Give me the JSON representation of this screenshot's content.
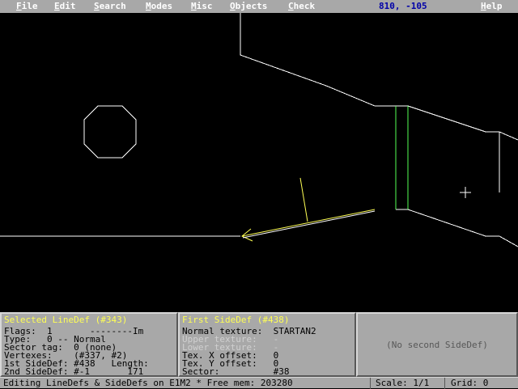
{
  "menu": {
    "items": [
      {
        "key": "F",
        "rest": "ile"
      },
      {
        "key": "E",
        "rest": "dit"
      },
      {
        "key": "S",
        "rest": "earch"
      },
      {
        "key": "M",
        "rest": "odes"
      },
      {
        "key": "M",
        "rest": "isc"
      },
      {
        "key": "O",
        "rest": "bjects"
      },
      {
        "key": "C",
        "rest": "heck"
      },
      {
        "key": "H",
        "rest": "elp"
      }
    ],
    "coords": "810, -105"
  },
  "colors": {
    "menubar": "#a8a8a8",
    "panel_title": "#ffff54",
    "coords": "#0000a8",
    "map_lines": "#ffffff",
    "selected_line": "#ffff54",
    "two_sided_line": "#54ff54"
  },
  "linedef_panel": {
    "title": "Selected LineDef (#343)",
    "rows": [
      "Flags:  1       --------Im",
      "Type:   0 -- Normal",
      "Sector tag:  0 (none)",
      "Vertexes:    (#337, #2)",
      "1st SideDef: #438   Length:",
      "2nd SideDef: #-1       171"
    ]
  },
  "sidedef1_panel": {
    "title": "First SideDef (#438)",
    "rows": [
      {
        "text": "Normal texture:  STARTAN2",
        "dim": false
      },
      {
        "text": "Upper texture:   -",
        "dim": true
      },
      {
        "text": "Lower texture:   -",
        "dim": true
      },
      {
        "text": "Tex. X offset:   0",
        "dim": false
      },
      {
        "text": "Tex. Y offset:   0",
        "dim": false
      },
      {
        "text": "Sector:          #38",
        "dim": false
      }
    ]
  },
  "sidedef2_panel": {
    "message": "(No second SideDef)"
  },
  "status": {
    "message": "Editing LineDefs & SideDefs on E1M2 * Free mem: 203280",
    "scale": "Scale: 1/1",
    "grid": "Grid: 0"
  }
}
